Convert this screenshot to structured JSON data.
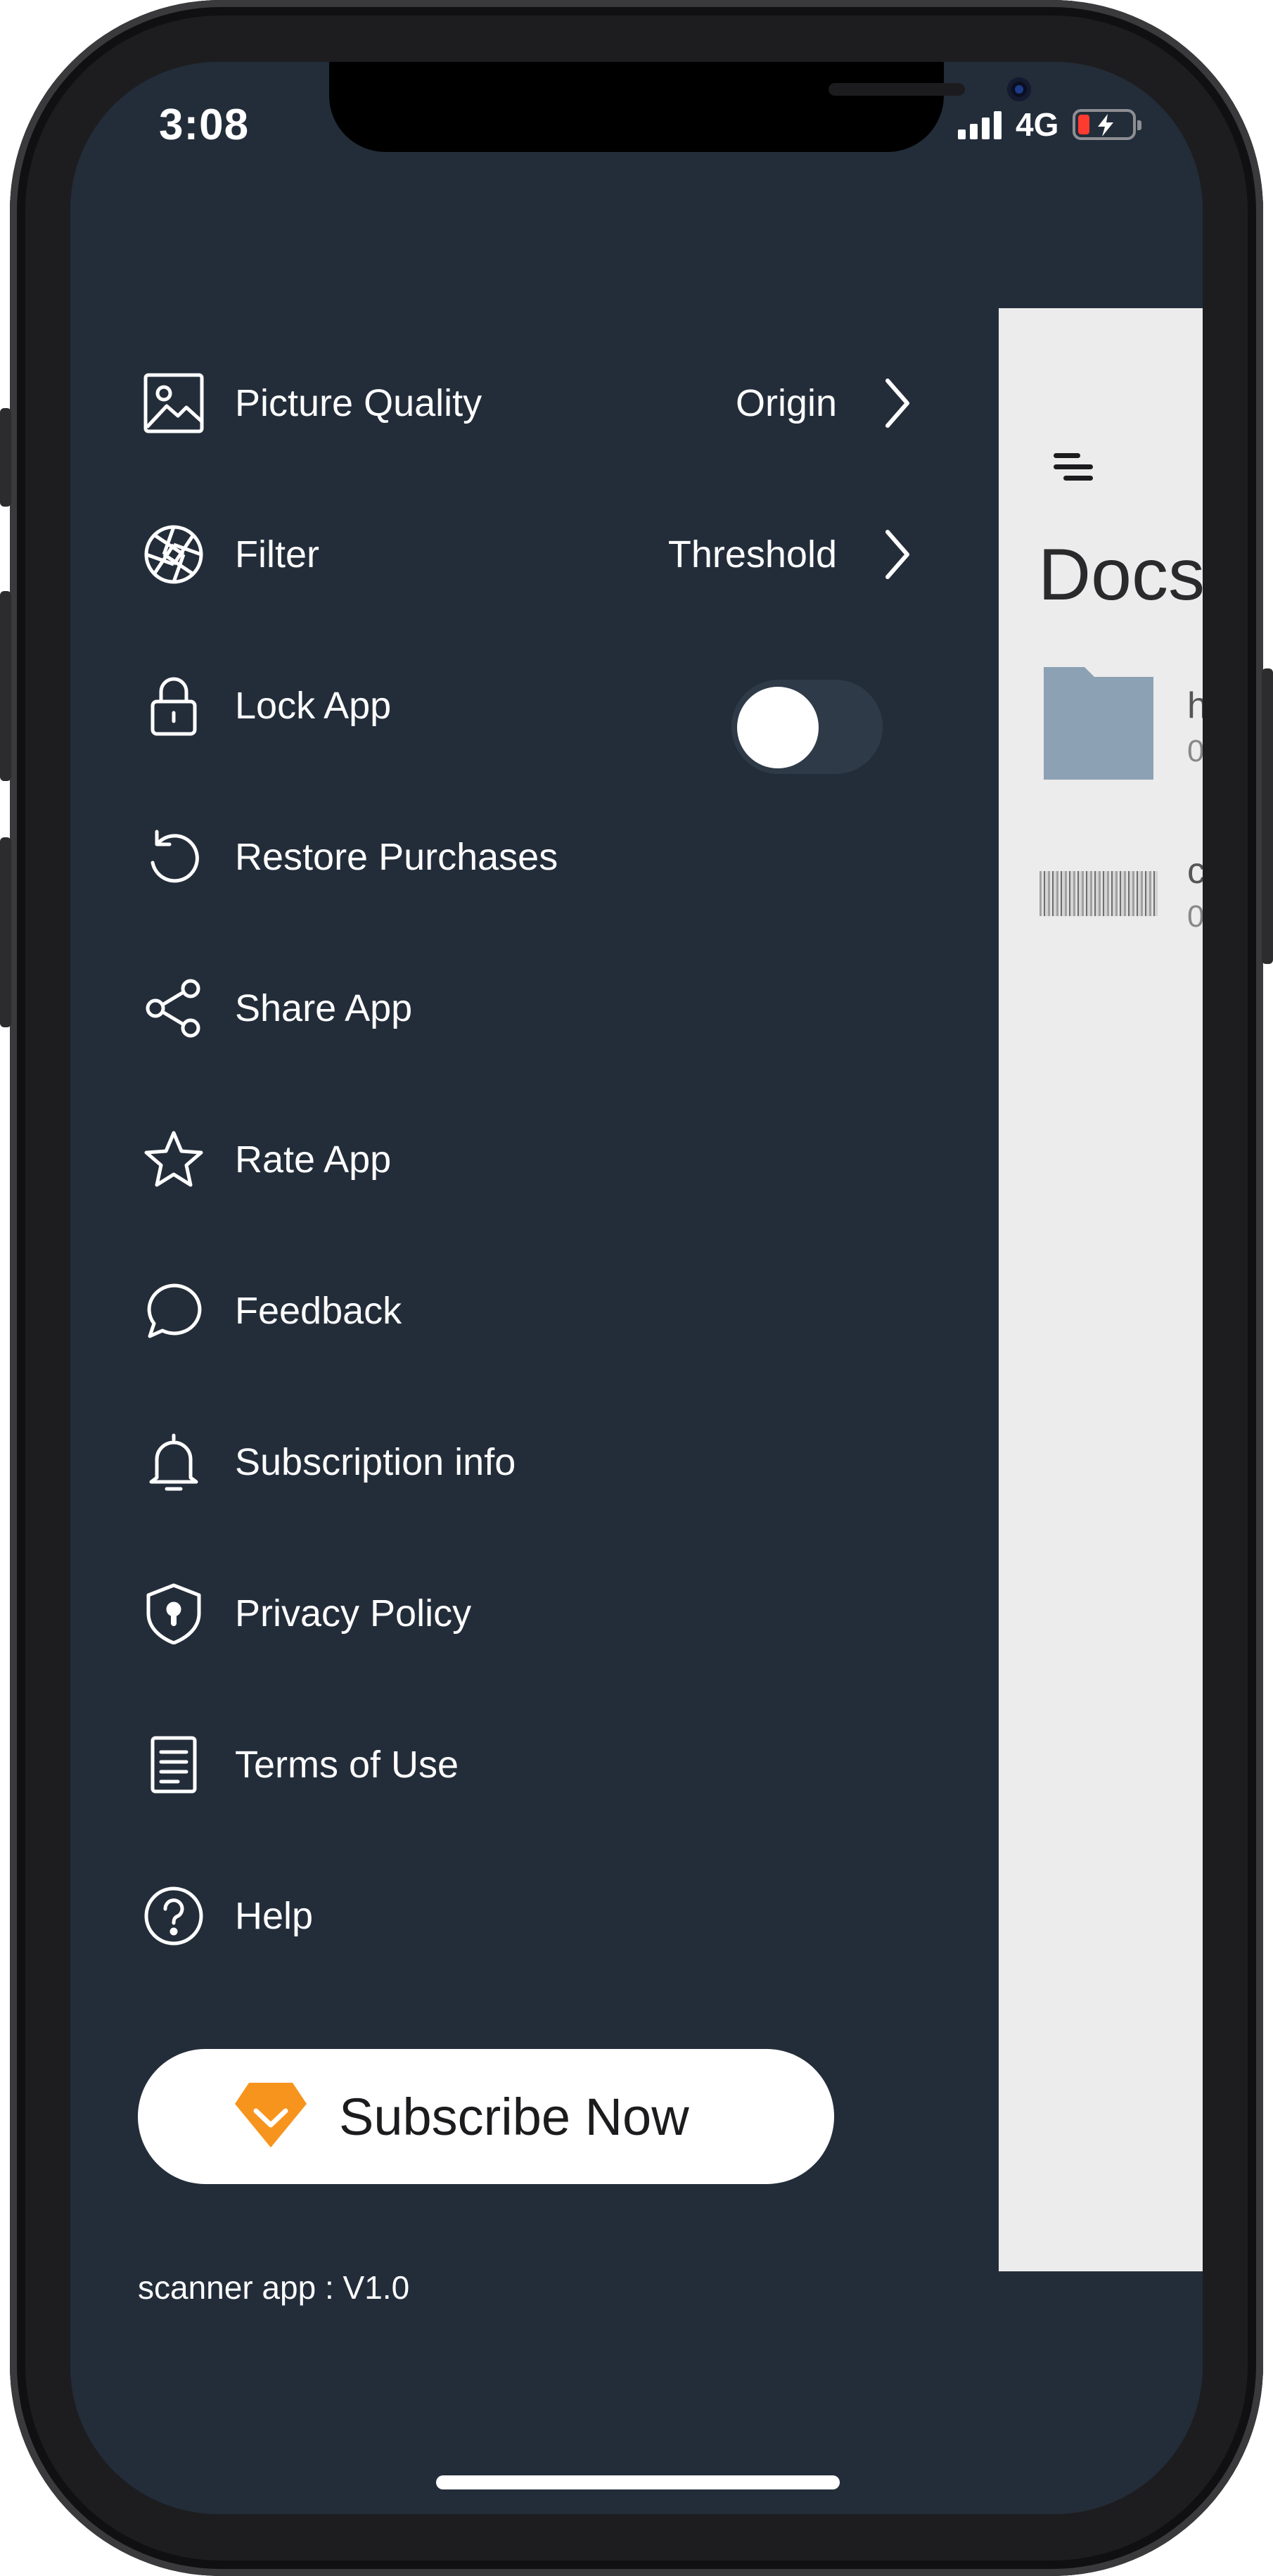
{
  "status_bar": {
    "time": "3:08",
    "network": "4G"
  },
  "menu": {
    "items": [
      {
        "label": "Picture Quality",
        "value": "Origin",
        "icon": "image-icon"
      },
      {
        "label": "Filter",
        "value": "Threshold",
        "icon": "aperture-icon"
      },
      {
        "label": "Lock App",
        "value": "",
        "icon": "lock-icon",
        "toggle_on": false
      },
      {
        "label": "Restore Purchases",
        "value": "",
        "icon": "restore-icon"
      },
      {
        "label": "Share App",
        "value": "",
        "icon": "share-icon"
      },
      {
        "label": "Rate App",
        "value": "",
        "icon": "star-icon"
      },
      {
        "label": "Feedback",
        "value": "",
        "icon": "chat-bubble-icon"
      },
      {
        "label": "Subscription info",
        "value": "",
        "icon": "bell-icon"
      },
      {
        "label": "Privacy Policy",
        "value": "",
        "icon": "shield-lock-icon"
      },
      {
        "label": "Terms of Use",
        "value": "",
        "icon": "document-icon"
      },
      {
        "label": "Help",
        "value": "",
        "icon": "help-circle-icon"
      }
    ]
  },
  "subscribe": {
    "label": "Subscribe Now",
    "icon": "diamond-icon",
    "icon_color": "#f7941d"
  },
  "footer": {
    "version": "scanner app : V1.0"
  },
  "background_screen": {
    "title": "Docs",
    "row1_name": "h",
    "row1_meta": "0",
    "row2_name": "c",
    "row2_meta": "0"
  },
  "colors": {
    "drawer_bg": "#232d3a",
    "panel_bg": "#ececec",
    "folder": "#8da1b5"
  }
}
